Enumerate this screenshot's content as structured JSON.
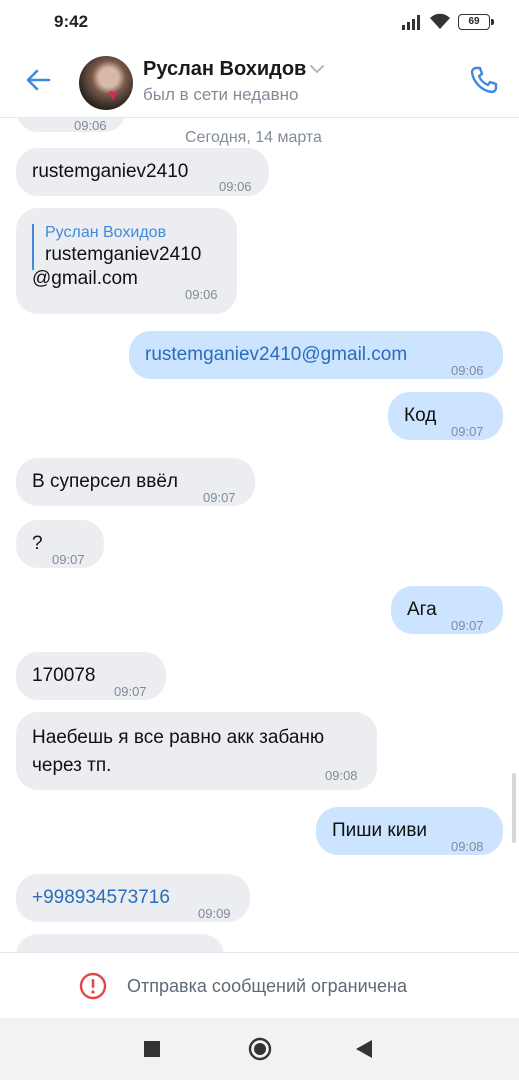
{
  "status_bar": {
    "time": "9:42",
    "battery": "69"
  },
  "header": {
    "contact_name": "Руслан Вохидов",
    "contact_status": "был в сети недавно"
  },
  "chat": {
    "partial_top_time": "09:06",
    "date_separator": "Сегодня, 14 марта",
    "messages": [
      {
        "dir": "in",
        "text": "rustemganiev2410",
        "time": "09:06"
      },
      {
        "dir": "in",
        "reply_author": "Руслан Вохидов",
        "reply_text": "rustemganiev2410",
        "text": "@gmail.com",
        "time": "09:06"
      },
      {
        "dir": "out",
        "text": "rustemganiev2410@gmail.com",
        "time": "09:06"
      },
      {
        "dir": "out",
        "text": "Код",
        "time": "09:07"
      },
      {
        "dir": "in",
        "text": "В суперсел ввёл",
        "time": "09:07"
      },
      {
        "dir": "in",
        "text": "?",
        "time": "09:07"
      },
      {
        "dir": "out",
        "text": "Ага",
        "time": "09:07"
      },
      {
        "dir": "in",
        "text": "170078",
        "time": "09:07"
      },
      {
        "dir": "in",
        "text": "Наебешь я все равно акк забаню через тп.",
        "line1": "Наебешь я все равно акк забаню",
        "line2": "через тп.",
        "time": "09:08"
      },
      {
        "dir": "out",
        "text": "Пиши киви",
        "time": "09:08"
      },
      {
        "dir": "in",
        "text": "+998934573716",
        "time": "09:09"
      }
    ]
  },
  "restriction_banner": {
    "text": "Отправка сообщений ограничена"
  },
  "colors": {
    "accent": "#3f8ae0",
    "incoming_bubble": "#ebedf0",
    "outgoing_bubble": "#cce4ff",
    "error": "#e64646"
  },
  "icons": [
    "signal-icon",
    "wifi-icon",
    "battery-icon",
    "back-arrow-icon",
    "chevron-down-icon",
    "phone-icon",
    "error-icon",
    "recent-apps-icon",
    "home-icon",
    "back-triangle-icon"
  ]
}
